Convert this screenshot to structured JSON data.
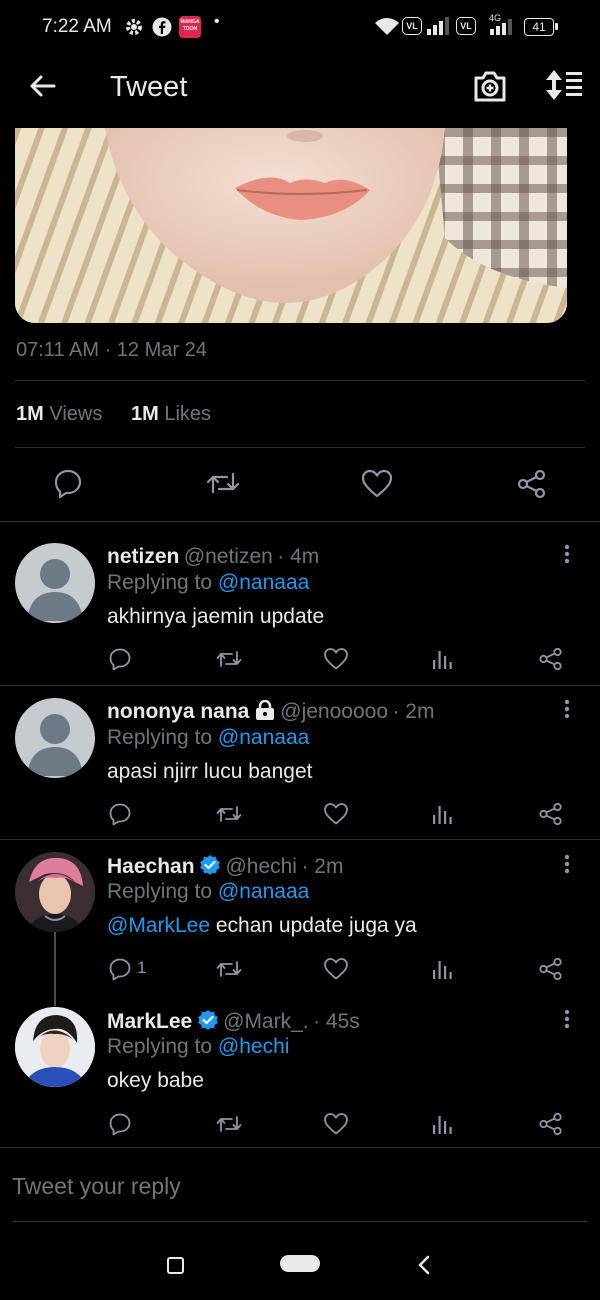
{
  "status_bar": {
    "time": "7:22 AM",
    "battery": "41",
    "network": "4G",
    "vl1": "VL",
    "vl2": "VL",
    "manga_badge": "MANGA TOON"
  },
  "header": {
    "title": "Tweet"
  },
  "tweet": {
    "timestamp": "07:11 AM · 12 Mar 24",
    "views_count": "1M",
    "views_label": "Views",
    "likes_count": "1M",
    "likes_label": "Likes"
  },
  "replies": [
    {
      "name": "netizen",
      "handle": "@netizen",
      "time": "· 4m",
      "replying_prefix": "Replying to",
      "replying_to": "@nanaaa",
      "text": "akhirnya jaemin update",
      "reply_count": ""
    },
    {
      "name": "nononya nana",
      "handle": "@jenooooo",
      "time": "· 2m",
      "replying_prefix": "Replying to",
      "replying_to": "@nanaaa",
      "text": "apasi njirr lucu banget",
      "reply_count": ""
    },
    {
      "name": "Haechan",
      "handle": "@hechi",
      "time": "· 2m",
      "replying_prefix": "Replying to",
      "replying_to": "@nanaaa",
      "mention": "@MarkLee",
      "text": " echan update juga ya",
      "reply_count": "1"
    },
    {
      "name": "MarkLee",
      "handle": "@Mark_.",
      "time": "· 45s",
      "replying_prefix": "Replying to",
      "replying_to": "@hechi",
      "text": "okey babe",
      "reply_count": ""
    }
  ],
  "compose": {
    "placeholder": "Tweet your reply"
  },
  "colors": {
    "background": "#000000",
    "accent": "#1d9bf0",
    "muted": "#6e767d",
    "divider": "#2f3336",
    "verified": "#1d9bf0"
  }
}
